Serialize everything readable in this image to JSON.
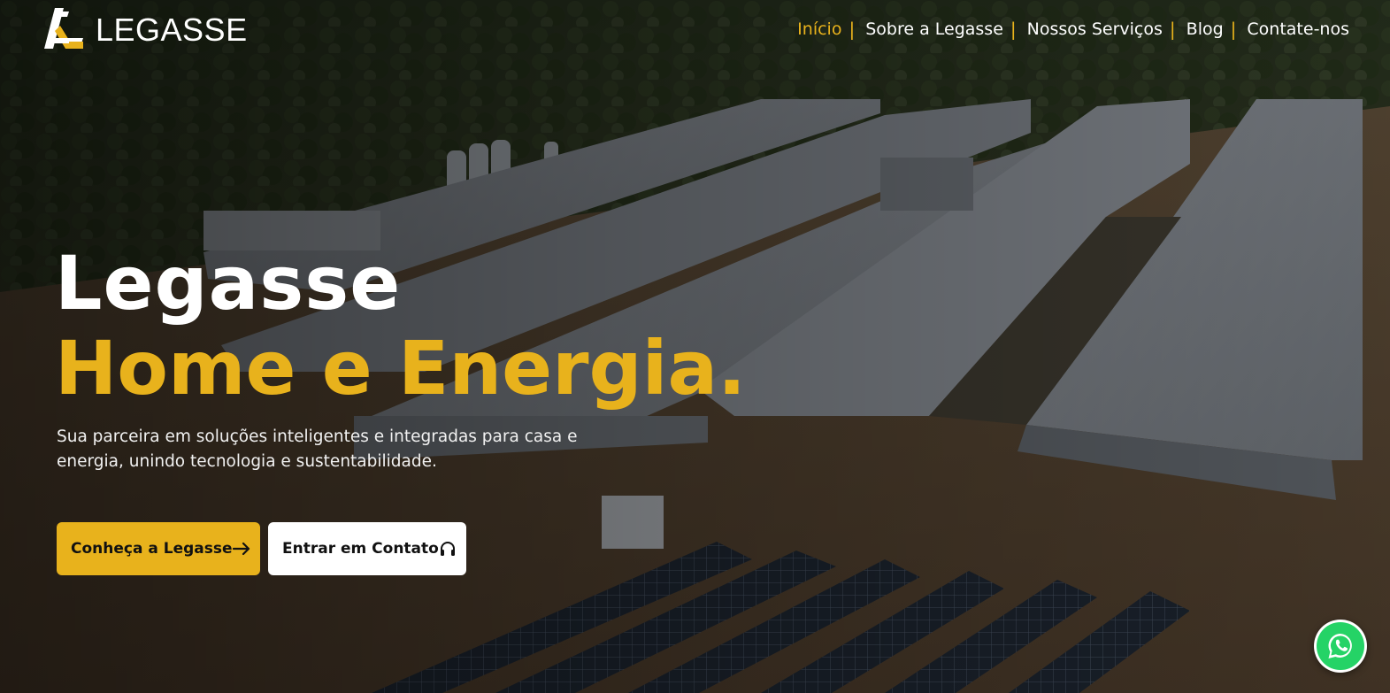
{
  "brand": {
    "name": "LEGASSE",
    "accent_color": "#e8b21c",
    "logo_icon": "legasse-logo-mark"
  },
  "nav": {
    "items": [
      {
        "label": "Início",
        "active": true
      },
      {
        "label": "Sobre a Legasse",
        "active": false
      },
      {
        "label": "Nossos Serviços",
        "active": false
      },
      {
        "label": "Blog",
        "active": false
      },
      {
        "label": "Contate-nos",
        "active": false
      }
    ],
    "separator": "|"
  },
  "hero": {
    "title_line1": "Legasse",
    "title_line2": "Home e Energia.",
    "subtitle": "Sua parceira em soluções inteligentes e integradas para casa e energia, unindo tecnologia e sustentabilidade.",
    "primary_button": {
      "label": "Conheça a Legasse",
      "icon": "arrow-right-icon"
    },
    "secondary_button": {
      "label": "Entrar em Contato",
      "icon": "headphones-icon"
    }
  },
  "floating": {
    "whatsapp_icon": "whatsapp-icon",
    "whatsapp_color": "#25d366"
  }
}
